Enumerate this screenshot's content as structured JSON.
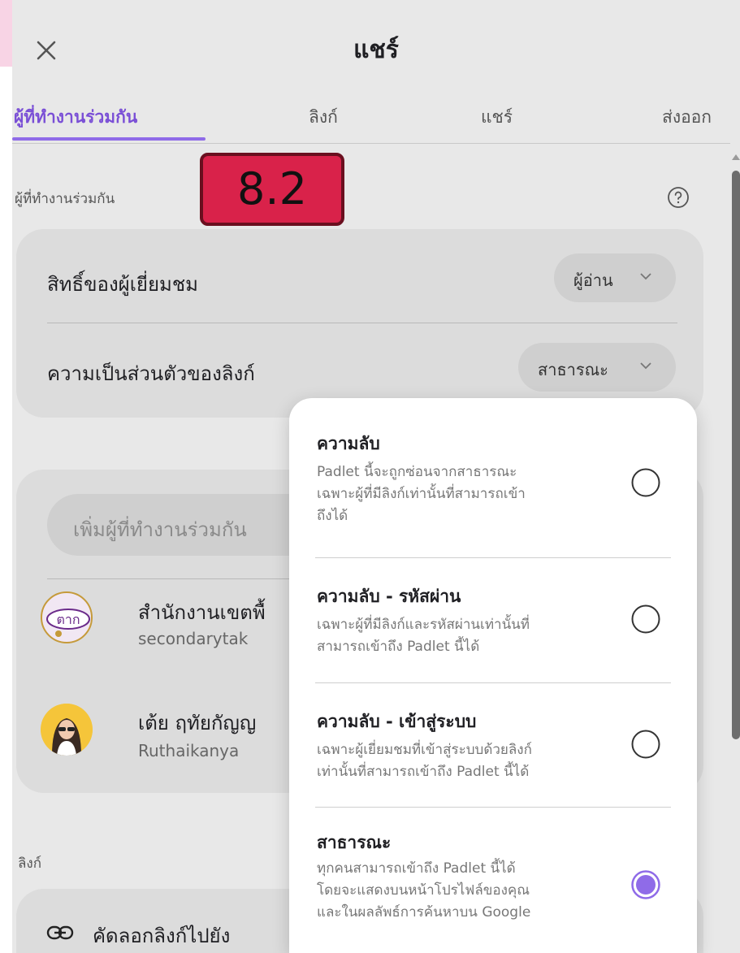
{
  "dialog": {
    "title": "แชร์",
    "close_icon": "close-icon"
  },
  "tabs": [
    {
      "label": "ผู้ที่ทำงานร่วมกัน",
      "active": true
    },
    {
      "label": "ลิงก์",
      "active": false
    },
    {
      "label": "แชร์",
      "active": false
    },
    {
      "label": "ส่งออก",
      "active": false
    }
  ],
  "overlay_badge": "8.2",
  "collaborators_section": {
    "label": "ผู้ที่ทำงานร่วมกัน",
    "help_icon": "question-circle-icon",
    "visitor_permission": {
      "label": "สิทธิ์ของผู้เยี่ยมชม",
      "value": "ผู้อ่าน"
    },
    "link_privacy": {
      "label": "ความเป็นส่วนตัวของลิงก์",
      "value": "สาธารณะ"
    }
  },
  "people": {
    "add_placeholder": "เพิ่มผู้ที่ทำงานร่วมกัน",
    "items": [
      {
        "name": "สำนักงานเขตพื้",
        "sub": "secondarytak",
        "avatar_text": "ตาก"
      },
      {
        "name": "เต้ย ฤทัยกัญญ",
        "sub": "Ruthaikanya"
      }
    ]
  },
  "links_section": {
    "label": "ลิงก์",
    "copy_label": "คัดลอกลิงก์ไปยัง"
  },
  "privacy_menu": {
    "options": [
      {
        "title": "ความลับ",
        "desc": [
          "Padlet นี้จะถูกซ่อนจากสาธารณะ",
          "เฉพาะผู้ที่มีลิงก์เท่านั้นที่สามารถเข้า",
          "ถึงได้"
        ],
        "selected": false
      },
      {
        "title": "ความลับ - รหัสผ่าน",
        "desc": [
          "เฉพาะผู้ที่มีลิงก์และรหัสผ่านเท่านั้นที่",
          "สามารถเข้าถึง Padlet นี้ได้"
        ],
        "selected": false
      },
      {
        "title": "ความลับ - เข้าสู่ระบบ",
        "desc": [
          "เฉพาะผู้เยี่ยมชมที่เข้าสู่ระบบด้วยลิงก์",
          "เท่านั้นที่สามารถเข้าถึง Padlet นี้ได้"
        ],
        "selected": false
      },
      {
        "title": "สาธารณะ",
        "desc": [
          "ทุกคนสามารถเข้าถึง Padlet นี้ได้",
          "โดยจะแสดงบนหน้าโปรไฟล์ของคุณ",
          "และในผลลัพธ์การค้นหาบน Google"
        ],
        "selected": true
      }
    ]
  },
  "colors": {
    "accent": "#8f6be8",
    "badge": "#d9224a",
    "panel": "#e8e8e8",
    "pink": "#f8d4e5"
  }
}
